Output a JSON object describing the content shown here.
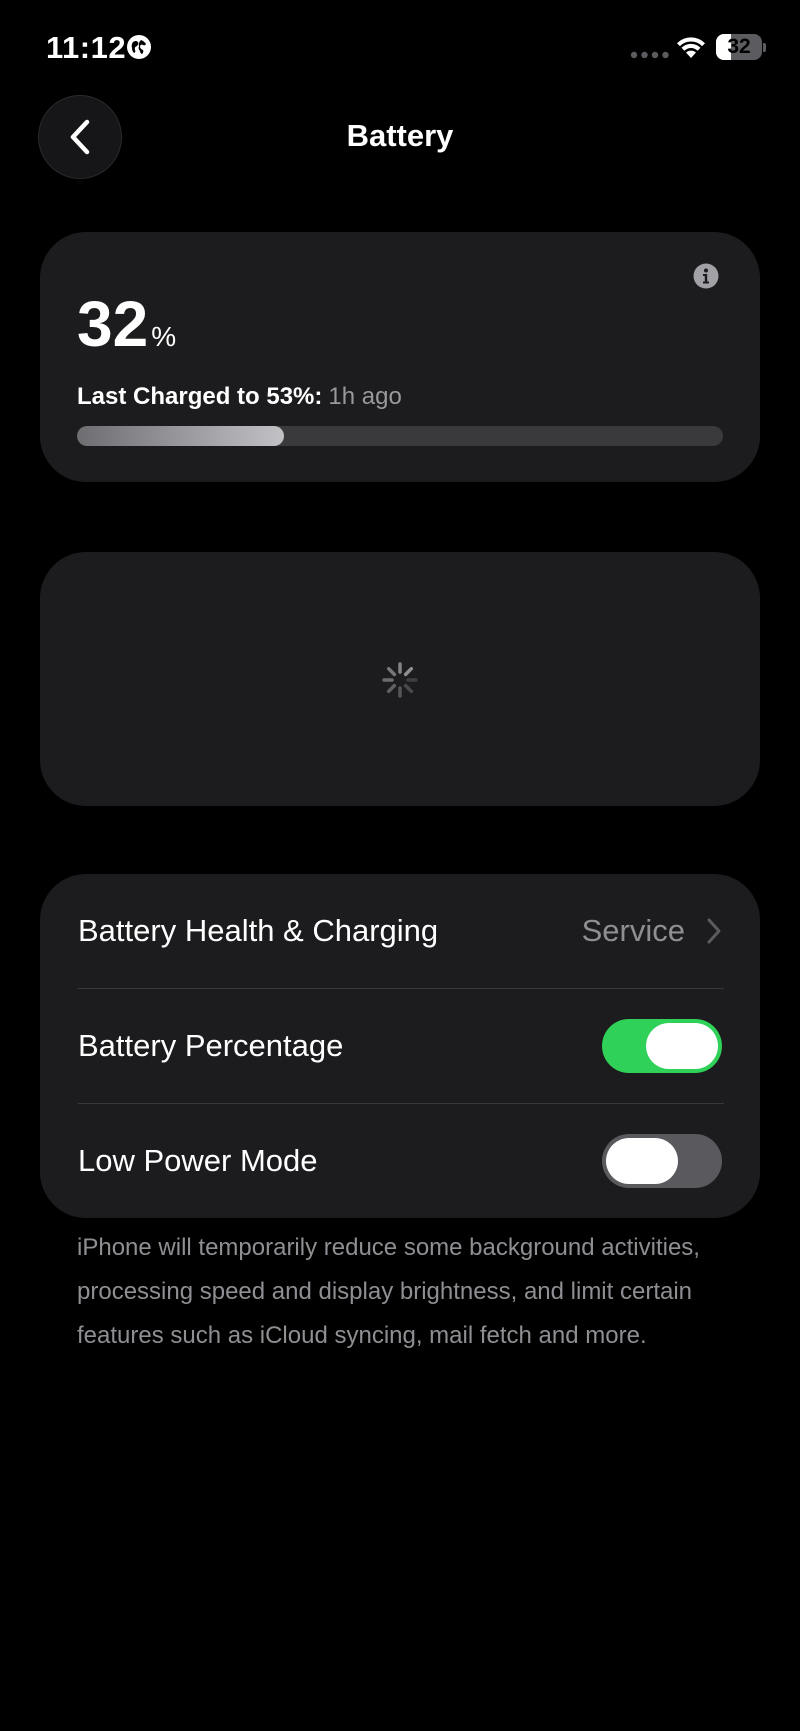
{
  "status_bar": {
    "time": "11:12",
    "battery_text": "32",
    "battery_level": 0.32,
    "icons": [
      "globe-icon",
      "signal-dots-icon",
      "wifi-icon",
      "battery-icon"
    ]
  },
  "nav": {
    "title": "Battery",
    "back_icon": "chevron-left-icon"
  },
  "battery_level": {
    "number": "32",
    "unit": "%",
    "last_charged_label": "Last Charged to 53%:",
    "last_charged_time": "1h ago",
    "bar_fill_fraction": 0.32,
    "info_icon": "info-icon"
  },
  "chart": {
    "loading_icon": "spinner-icon"
  },
  "settings": {
    "rows": [
      {
        "label": "Battery Health & Charging",
        "value": "Service",
        "type": "link"
      },
      {
        "label": "Battery Percentage",
        "type": "toggle",
        "on": true
      },
      {
        "label": "Low Power Mode",
        "type": "toggle",
        "on": false
      }
    ],
    "footnote": "iPhone will temporarily reduce some background activities, processing speed and display brightness, and limit certain features such as iCloud syncing, mail fetch and more."
  },
  "colors": {
    "background": "#000000",
    "card": "#1c1c1e",
    "toggle_on": "#30d158",
    "toggle_off": "#59595e",
    "secondary_text": "#8e8e93"
  }
}
